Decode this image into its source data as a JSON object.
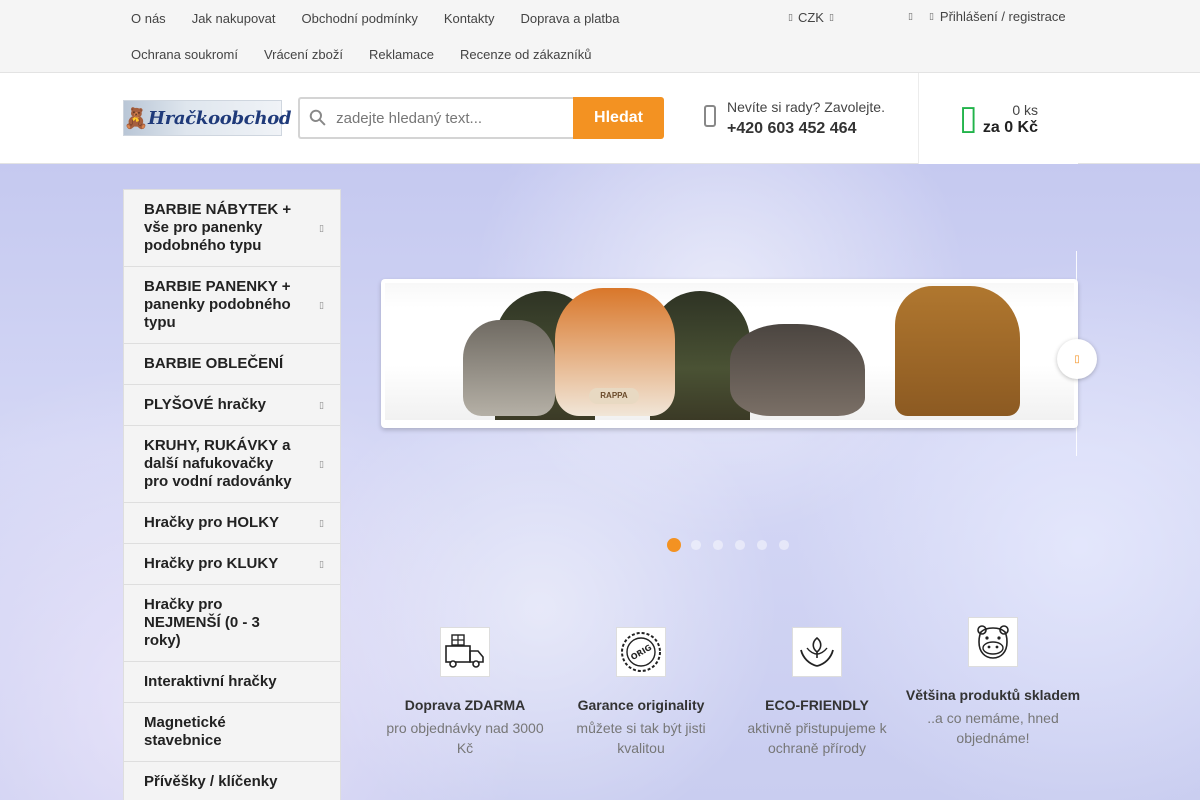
{
  "top_nav": {
    "row1": [
      "O nás",
      "Jak nakupovat",
      "Obchodní podmínky",
      "Kontakty",
      "Doprava a platba"
    ],
    "row2": [
      "Ochrana soukromí",
      "Vrácení zboží",
      "Reklamace",
      "Recenze od zákazníků"
    ],
    "currency": "CZK",
    "account": "Přihlášení / registrace"
  },
  "header": {
    "logo_text": "Hračkoobchod",
    "search_placeholder": "zadejte hledaný text...",
    "search_button": "Hledat",
    "help_text": "Nevíte si rady? Zavolejte.",
    "phone": "+420 603 452 464",
    "cart_count": "0 ks",
    "cart_total": "za 0 Kč"
  },
  "categories": [
    {
      "label": "BARBIE NÁBYTEK + vše pro panenky podobného typu",
      "has_sub": true
    },
    {
      "label": "BARBIE PANENKY + panenky podobného typu",
      "has_sub": true
    },
    {
      "label": "BARBIE OBLEČENÍ",
      "has_sub": false
    },
    {
      "label": "PLYŠOVÉ hračky",
      "has_sub": true
    },
    {
      "label": "KRUHY, RUKÁVKY a další nafukovačky pro vodní radovánky",
      "has_sub": true
    },
    {
      "label": "Hračky pro HOLKY",
      "has_sub": true
    },
    {
      "label": "Hračky pro KLUKY",
      "has_sub": true
    },
    {
      "label": "Hračky pro NEJMENŠÍ (0 - 3 roky)",
      "has_sub": false
    },
    {
      "label": "Interaktivní hračky",
      "has_sub": false
    },
    {
      "label": "Magnetické stavebnice",
      "has_sub": false
    },
    {
      "label": "Přívěšky / klíčenky",
      "has_sub": false
    }
  ],
  "slider": {
    "slide_count": 6,
    "active_index": 0,
    "banner_logo": "RAPPA"
  },
  "benefits": [
    {
      "icon": "delivery-truck-icon",
      "title": "Doprava ZDARMA",
      "desc": "pro objednávky nad 3000 Kč"
    },
    {
      "icon": "original-stamp-icon",
      "title": "Garance originality",
      "desc": "můžete si tak být jisti kvalitou"
    },
    {
      "icon": "eco-hands-icon",
      "title": "ECO-FRIENDLY",
      "desc": "aktivně přistupujeme k ochraně přírody"
    },
    {
      "icon": "hippo-icon",
      "title": "Většina produktů skladem",
      "desc": "..a co nemáme, hned objednáme!"
    }
  ],
  "colors": {
    "accent": "#f39222",
    "cart_icon": "#21b34a",
    "hero_bg": "#c9cdf0"
  }
}
